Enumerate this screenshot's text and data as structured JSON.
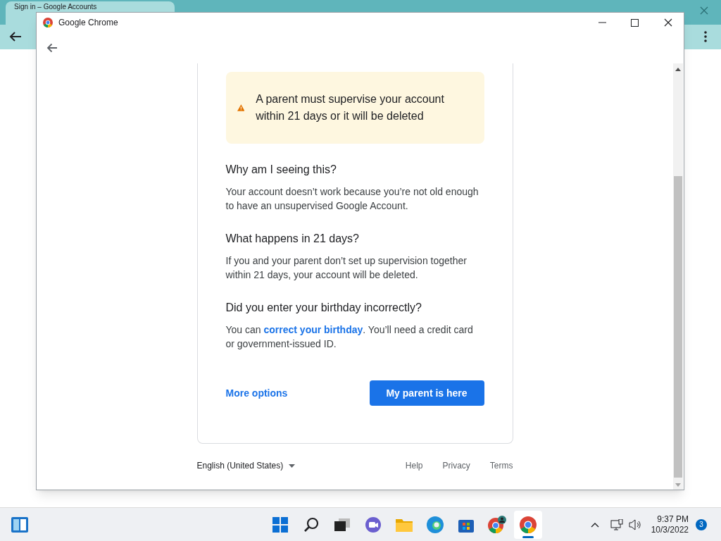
{
  "background_browser": {
    "tab_title": "Sign in – Google Accounts"
  },
  "window": {
    "title": "Google Chrome"
  },
  "alert": {
    "text": "A parent must supervise your account within 21 days or it will be deleted"
  },
  "sections": [
    {
      "heading": "Why am I seeing this?",
      "body": "Your account doesn’t work because you’re not old enough to have an unsupervised Google Account."
    },
    {
      "heading": "What happens in 21 days?",
      "body": "If you and your parent don’t set up supervision together within 21 days, your account will be deleted."
    },
    {
      "heading": "Did you enter your birthday incorrectly?",
      "body_before": "You can ",
      "link": "correct your birthday",
      "body_after": ". You’ll need a credit card or government-issued ID."
    }
  ],
  "actions": {
    "secondary": "More options",
    "primary": "My parent is here"
  },
  "footer": {
    "language": "English (United States)",
    "links": [
      "Help",
      "Privacy",
      "Terms"
    ]
  },
  "taskbar": {
    "time": "9:37 PM",
    "date": "10/3/2022",
    "notifications": "3"
  }
}
